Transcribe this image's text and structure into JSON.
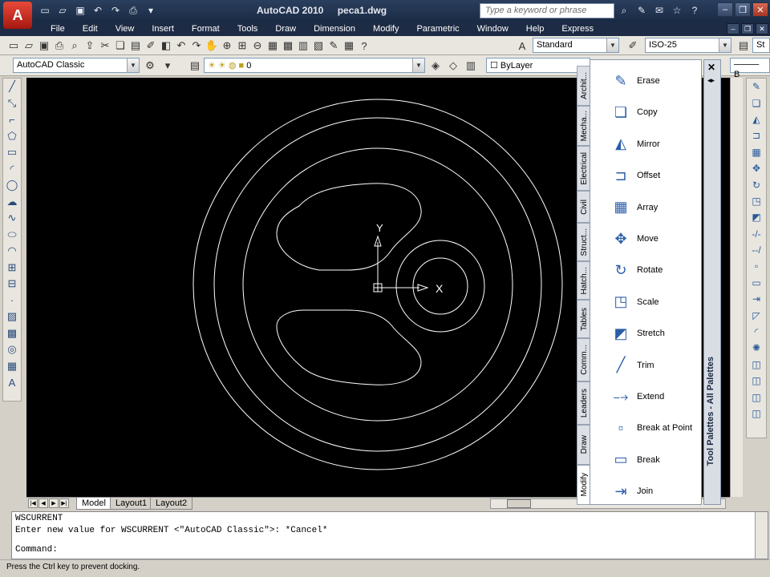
{
  "titlebar": {
    "app": "AutoCAD 2010",
    "file": "peca1.dwg",
    "search_placeholder": "Type a keyword or phrase",
    "app_button_letter": "A"
  },
  "menubar": {
    "items": [
      "File",
      "Edit",
      "View",
      "Insert",
      "Format",
      "Tools",
      "Draw",
      "Dimension",
      "Modify",
      "Parametric",
      "Window",
      "Help",
      "Express"
    ]
  },
  "toolbar1": {
    "text_style": "Standard",
    "dim_style": "ISO-25",
    "right_partial": "St"
  },
  "toolbar2": {
    "workspace": "AutoCAD Classic",
    "layer": "0",
    "color": "ByLayer"
  },
  "canvas": {
    "ucs_y": "Y",
    "ucs_x": "X"
  },
  "layout_tabs": [
    "Model",
    "Layout1",
    "Layout2"
  ],
  "command": {
    "line1": "WSCURRENT",
    "line2": "Enter new value for WSCURRENT <\"AutoCAD Classic\">: *Cancel*",
    "prompt": "Command:"
  },
  "status": "Press the Ctrl key to prevent docking.",
  "palette": {
    "title": "Tool Palettes - All Palettes",
    "tabs": [
      "Modify",
      "Draw",
      "Leaders",
      "Comm...",
      "Tables",
      "Hatch...",
      "Struct...",
      "Civil",
      "Electrical",
      "Mecha...",
      "Archit..."
    ],
    "active_tab": "Modify",
    "items": [
      {
        "label": "Erase",
        "icon": "eraser-icon"
      },
      {
        "label": "Copy",
        "icon": "copy-icon"
      },
      {
        "label": "Mirror",
        "icon": "mirror-icon"
      },
      {
        "label": "Offset",
        "icon": "offset-icon"
      },
      {
        "label": "Array",
        "icon": "array-icon"
      },
      {
        "label": "Move",
        "icon": "move-icon"
      },
      {
        "label": "Rotate",
        "icon": "rotate-icon"
      },
      {
        "label": "Scale",
        "icon": "scale-icon"
      },
      {
        "label": "Stretch",
        "icon": "stretch-icon"
      },
      {
        "label": "Trim",
        "icon": "trim-icon"
      },
      {
        "label": "Extend",
        "icon": "extend-icon"
      },
      {
        "label": "Break at Point",
        "icon": "break-at-point-icon"
      },
      {
        "label": "Break",
        "icon": "break-icon"
      },
      {
        "label": "Join",
        "icon": "join-icon"
      }
    ]
  }
}
